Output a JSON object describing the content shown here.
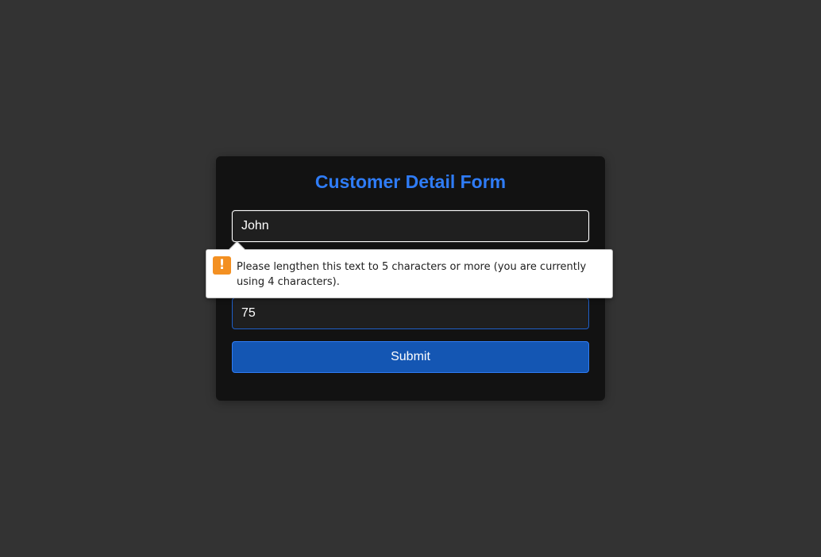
{
  "form": {
    "title": "Customer Detail Form",
    "name_value": "John",
    "amount_value": "75",
    "submit_label": "Submit"
  },
  "validation": {
    "icon": "warning-icon",
    "message": "Please lengthen this text to 5 characters or more (you are currently using 4 characters)."
  },
  "colors": {
    "page_background": "#333333",
    "card_background": "#121212",
    "title_accent": "#2f7cf6",
    "button_background": "#1456b3",
    "warning": "#f39022"
  }
}
